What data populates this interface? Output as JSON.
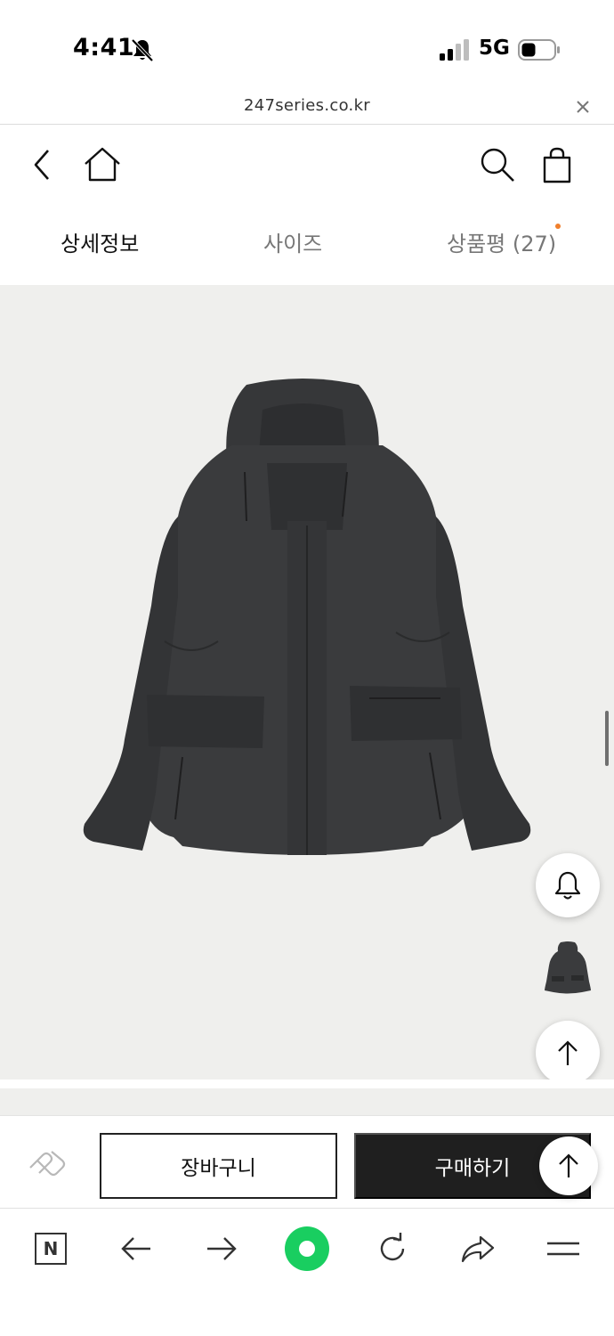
{
  "status_bar": {
    "time": "4:41",
    "network": "5G",
    "icons": [
      "bell-slash-icon",
      "signal-icon",
      "battery-icon"
    ]
  },
  "url_bar": {
    "url": "247series.co.kr",
    "close_icon": "close-icon"
  },
  "header": {
    "icons": [
      "back-chevron-icon",
      "home-icon",
      "search-icon",
      "shopping-bag-icon"
    ]
  },
  "tabs": [
    {
      "label": "상세정보",
      "active": true
    },
    {
      "label": "사이즈",
      "active": false
    },
    {
      "label": "상품평 (27)",
      "active": false,
      "has_new_dot": true
    }
  ],
  "product": {
    "image_icon": "jacket-image",
    "background": "#efefed"
  },
  "floating": {
    "icons": [
      "bell-icon",
      "product-thumbnail",
      "arrow-up-icon"
    ]
  },
  "action_bar": {
    "wish_icon": "heart-icon",
    "cart_label": "장바구니",
    "buy_label": "구매하기",
    "top_icon": "arrow-up-icon"
  },
  "browser_toolbar": {
    "icons": [
      "naver-n-icon",
      "back-arrow-icon",
      "forward-arrow-icon",
      "naver-green-icon",
      "reload-icon",
      "share-icon",
      "menu-icon"
    ]
  },
  "colors": {
    "accent_dot": "#f07f2c",
    "buy_button": "#1f1f1f",
    "naver_green": "#19ce60"
  }
}
